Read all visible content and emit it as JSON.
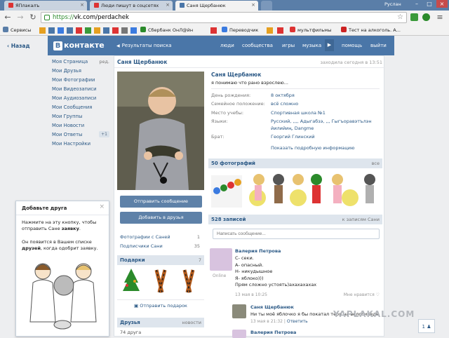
{
  "browser": {
    "tabs": [
      {
        "label": "ЯПлакалъ",
        "color": "#d33"
      },
      {
        "label": "Люди пишут в соцсетях",
        "color": "#d33"
      },
      {
        "label": "Саня Щербанюк",
        "color": "#4a76a8"
      }
    ],
    "user": "Руслан",
    "url_scheme": "https://",
    "url_rest": "vk.com/perdachek",
    "bookmarks": [
      "Сервисы",
      "Сбербанк ОнЛ@йн",
      "Переводчик",
      "мультфильмы",
      "Тест на алкоголь. А..."
    ]
  },
  "vk": {
    "back": "Назад",
    "logo_b": "В",
    "logo_text": "контакте",
    "results": "Результаты поиска",
    "menu": [
      "люди",
      "сообщества",
      "игры",
      "музыка",
      "помощь",
      "выйти"
    ],
    "left_nav": [
      {
        "label": "Моя Страница",
        "right": "ред."
      },
      {
        "label": "Мои Друзья",
        "right": ""
      },
      {
        "label": "Мои Фотографии",
        "right": ""
      },
      {
        "label": "Мои Видеозаписи",
        "right": ""
      },
      {
        "label": "Мои Аудиозаписи",
        "right": ""
      },
      {
        "label": "Мои Сообщения",
        "right": ""
      },
      {
        "label": "Мои Группы",
        "right": ""
      },
      {
        "label": "Мои Новости",
        "right": ""
      },
      {
        "label": "Мои Ответы",
        "right": "+1"
      },
      {
        "label": "Мои Настройки",
        "right": ""
      }
    ]
  },
  "popup": {
    "title": "Добавьте друга",
    "text1a": "Нажмите на эту кнопку, чтобы отправить Сане ",
    "text1b": "заявку",
    "text2a": "Он появится в Вашем списке ",
    "text2b": "друзей",
    "text2c": ", когда одобрит заявку."
  },
  "profile": {
    "name": "Саня Щербанюк",
    "last_seen": "заходила сегодня в 13:51",
    "status": "я понимаю что рано взрослею...",
    "send_message": "Отправить сообщение",
    "add_friend": "Добавить в друзья",
    "photos_with": "Фотографии с Саней",
    "photos_with_count": "1",
    "subscribers": "Подписчики Сани",
    "subscribers_count": "35",
    "gifts": "Подарки",
    "gifts_count": "7",
    "send_gift": "Отправить подарок",
    "friends": "Друзья",
    "friends_link": "новости",
    "friends_count": "74 друга",
    "info": [
      {
        "k": "День рождения:",
        "v": "8 октября"
      },
      {
        "k": "Семейное положение:",
        "v": "всё сложно"
      },
      {
        "k": "Место учебы:",
        "v": "Спортивная школа №1"
      },
      {
        "k": "Языки:",
        "v": "Русский, ,,,, Адыгабзэ, ,,, Гыгъоравэтълэн"
      },
      {
        "k": "",
        "v": "йилийиң, Dangme"
      },
      {
        "k": "Брат:",
        "v": "Георгий Глинский"
      }
    ],
    "more_info": "Показать подробную информацию",
    "photos_head": "50 фотографий",
    "photos_all": "все",
    "wall_head": "528 записей",
    "wall_link": "к записям Сани",
    "wall_placeholder": "Написать сообщение...",
    "post1": {
      "author": "Валерия Петрова",
      "online": "Online",
      "lines": [
        "С- секи.",
        "А- опасный.",
        "Н- никудышное",
        "Я- яблоко)))",
        "Прям сложно устоять)ахахахахах"
      ],
      "time": "13 мая в 10:25",
      "likes": "Мне нравится"
    },
    "reply": {
      "author": "Саня Щербанюк",
      "text": "Ни ты моё яблочко я бы покатал тебя на велосипеде",
      "time": "13 мая в 21:32",
      "answer": "Ответить"
    },
    "post2_author": "Валерия Петрова"
  },
  "watermark": "YAPLAKAL.COM",
  "bottom_count": "1"
}
